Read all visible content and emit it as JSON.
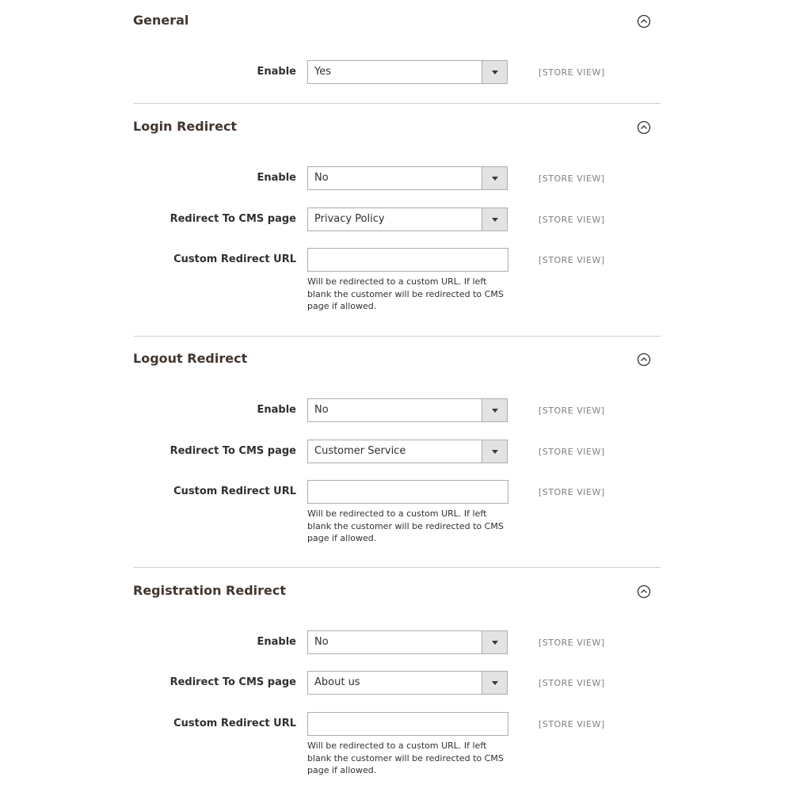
{
  "sections": [
    {
      "title": "General",
      "collapse_icon": "chevron-up-circle-icon",
      "fields": [
        {
          "label": "Enable",
          "type": "select",
          "value": "Yes",
          "scope": "[STORE VIEW]"
        }
      ]
    },
    {
      "title": "Login Redirect",
      "collapse_icon": "chevron-up-circle-icon",
      "fields": [
        {
          "label": "Enable",
          "type": "select",
          "value": "No",
          "scope": "[STORE VIEW]"
        },
        {
          "label": "Redirect To CMS page",
          "type": "select",
          "value": "Privacy Policy",
          "scope": "[STORE VIEW]"
        },
        {
          "label": "Custom Redirect URL",
          "type": "text",
          "value": "",
          "scope": "[STORE VIEW]",
          "note": "Will be redirected to a custom URL. If left blank the customer will be redirected to CMS page if allowed."
        }
      ]
    },
    {
      "title": "Logout Redirect",
      "collapse_icon": "chevron-up-circle-icon",
      "fields": [
        {
          "label": "Enable",
          "type": "select",
          "value": "No",
          "scope": "[STORE VIEW]"
        },
        {
          "label": "Redirect To CMS page",
          "type": "select",
          "value": "Customer Service",
          "scope": "[STORE VIEW]"
        },
        {
          "label": "Custom Redirect URL",
          "type": "text",
          "value": "",
          "scope": "[STORE VIEW]",
          "note": "Will be redirected to a custom URL. If left blank the customer will be redirected to CMS page if allowed."
        }
      ]
    },
    {
      "title": "Registration Redirect",
      "collapse_icon": "chevron-up-circle-icon",
      "fields": [
        {
          "label": "Enable",
          "type": "select",
          "value": "No",
          "scope": "[STORE VIEW]"
        },
        {
          "label": "Redirect To CMS page",
          "type": "select",
          "value": "About us",
          "scope": "[STORE VIEW]"
        },
        {
          "label": "Custom Redirect URL",
          "type": "text",
          "value": "",
          "scope": "[STORE VIEW]",
          "note": "Will be redirected to a custom URL. If left blank the customer will be redirected to CMS page if allowed."
        }
      ]
    }
  ]
}
